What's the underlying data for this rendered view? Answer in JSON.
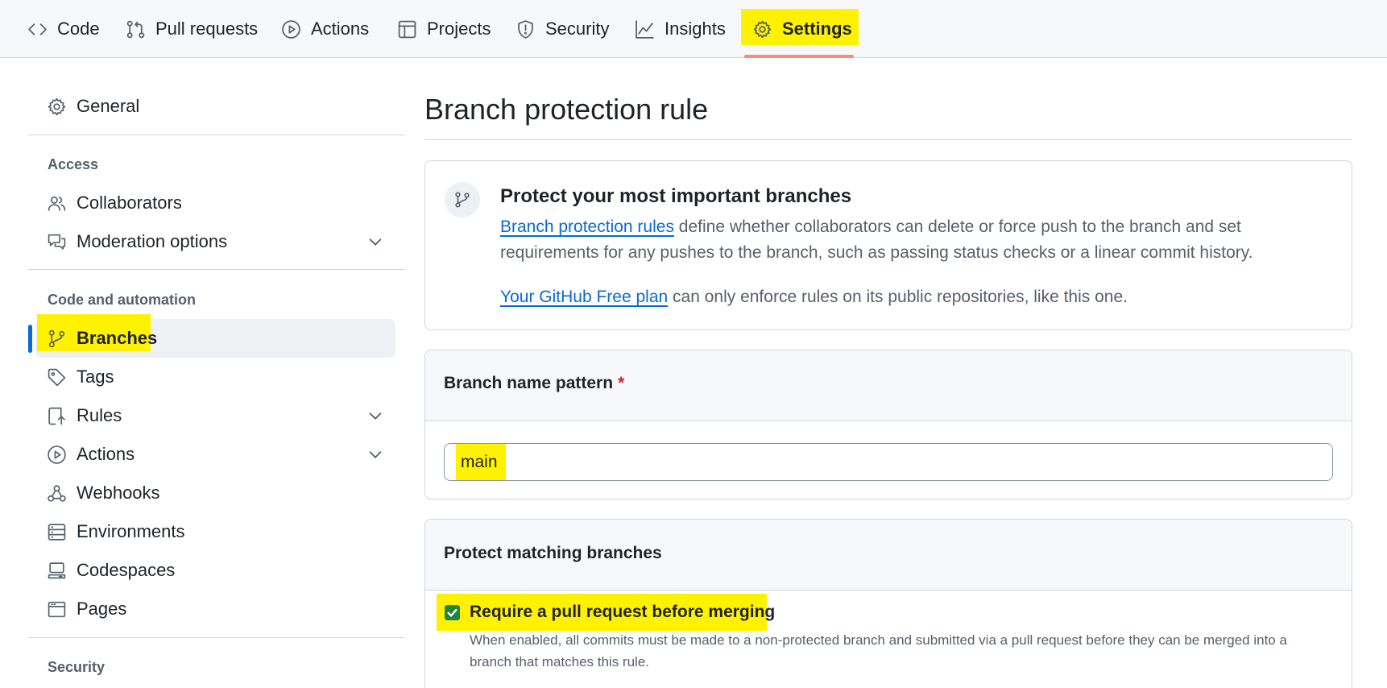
{
  "topnav": {
    "tabs": [
      {
        "label": "Code",
        "icon": "code-icon"
      },
      {
        "label": "Pull requests",
        "icon": "pull-request-icon"
      },
      {
        "label": "Actions",
        "icon": "play-icon"
      },
      {
        "label": "Projects",
        "icon": "table-icon"
      },
      {
        "label": "Security",
        "icon": "shield-icon"
      },
      {
        "label": "Insights",
        "icon": "graph-icon"
      },
      {
        "label": "Settings",
        "icon": "gear-icon",
        "active": true
      }
    ]
  },
  "sidebar": {
    "general": {
      "label": "General",
      "icon": "gear-icon"
    },
    "access": {
      "heading": "Access",
      "items": [
        {
          "label": "Collaborators",
          "icon": "people-icon"
        },
        {
          "label": "Moderation options",
          "icon": "comment-discussion-icon",
          "expandable": true
        }
      ]
    },
    "code_automation": {
      "heading": "Code and automation",
      "items": [
        {
          "label": "Branches",
          "icon": "git-branch-icon",
          "selected": true
        },
        {
          "label": "Tags",
          "icon": "tag-icon"
        },
        {
          "label": "Rules",
          "icon": "repo-push-icon",
          "expandable": true
        },
        {
          "label": "Actions",
          "icon": "play-icon",
          "expandable": true
        },
        {
          "label": "Webhooks",
          "icon": "webhook-icon"
        },
        {
          "label": "Environments",
          "icon": "server-icon"
        },
        {
          "label": "Codespaces",
          "icon": "codespaces-icon"
        },
        {
          "label": "Pages",
          "icon": "browser-icon"
        }
      ]
    },
    "security": {
      "heading": "Security"
    }
  },
  "main": {
    "title": "Branch protection rule",
    "promo": {
      "icon": "git-branch-icon",
      "title": "Protect your most important branches",
      "p1_link": "Branch protection rules",
      "p1_text": " define whether collaborators can delete or force push to the branch and set requirements for any pushes to the branch, such as passing status checks or a linear commit history.",
      "p2_link": "Your GitHub Free plan",
      "p2_text": " can only enforce rules on its public repositories, like this one."
    },
    "pattern": {
      "label": "Branch name pattern",
      "required_marker": "*",
      "value": "main"
    },
    "protect": {
      "label": "Protect matching branches",
      "rule": {
        "checked": true,
        "label": "Require a pull request before merging",
        "description": "When enabled, all commits must be made to a non-protected branch and submitted via a pull request before they can be merged into a branch that matches this rule."
      }
    }
  },
  "colors": {
    "highlight": "#fff200",
    "link": "#0969da",
    "selected_bar": "#0969da",
    "active_tab_underline": "#fd8c73",
    "checkbox": "#1f883d",
    "required": "#cf222e"
  }
}
